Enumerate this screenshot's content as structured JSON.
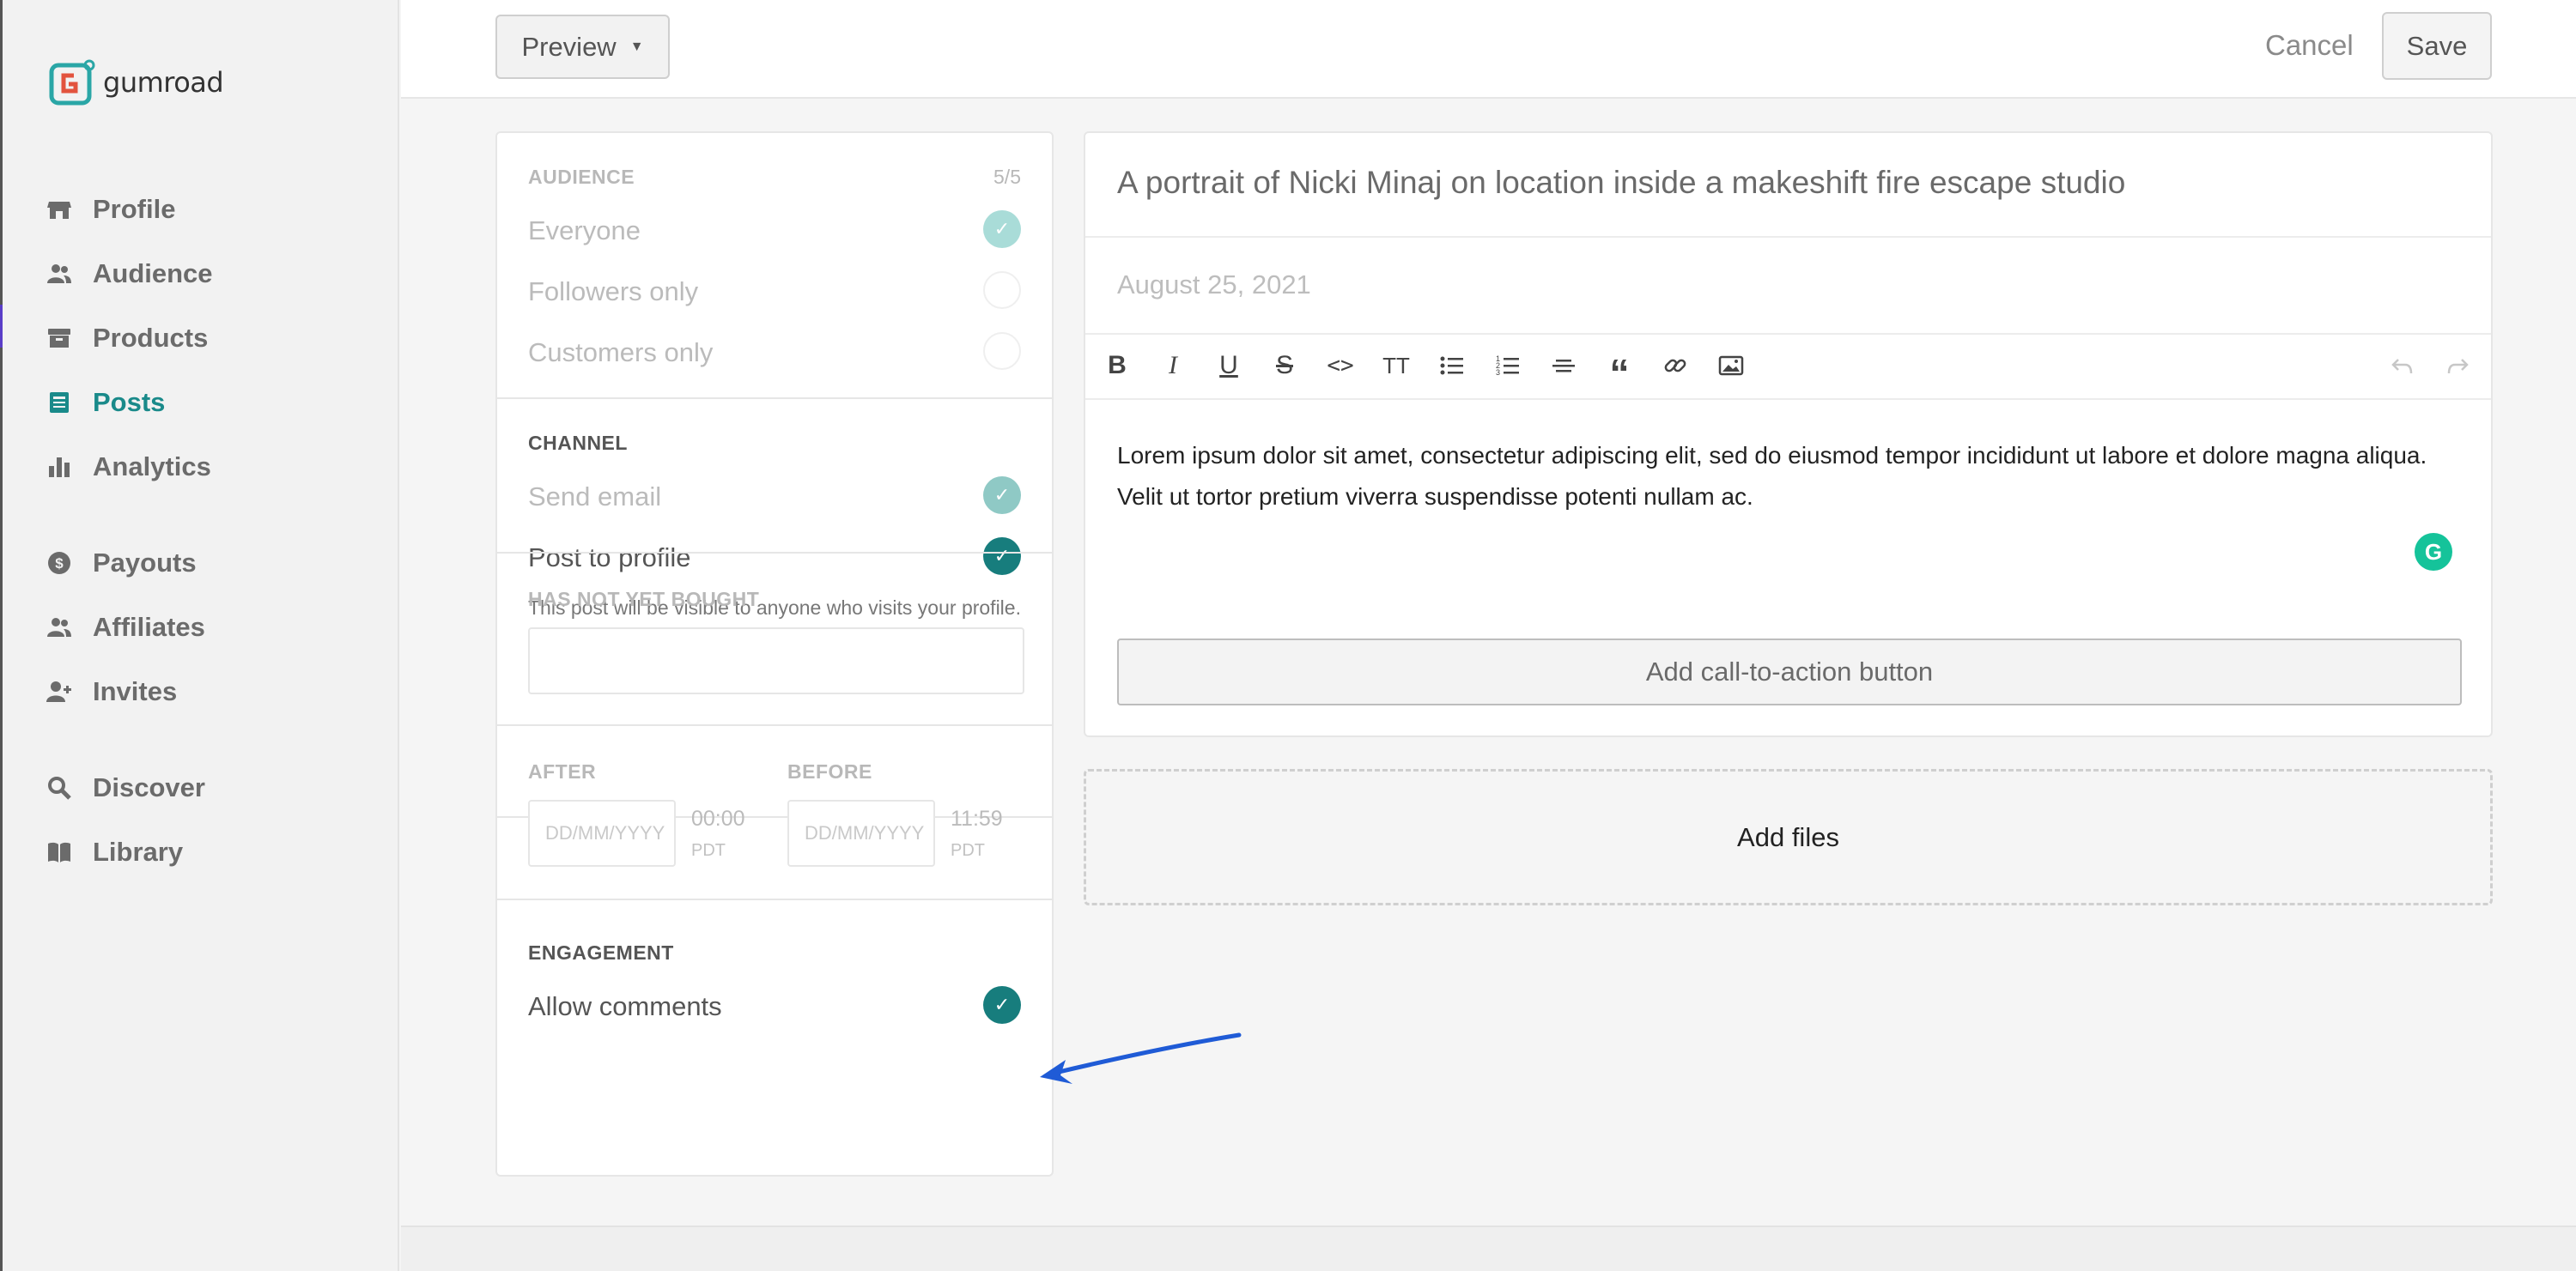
{
  "app": {
    "logo_text": "gumroad"
  },
  "sidebar": {
    "items": [
      {
        "label": "Profile",
        "icon": "store-icon",
        "active": false
      },
      {
        "label": "Audience",
        "icon": "users-icon",
        "active": false
      },
      {
        "label": "Products",
        "icon": "archive-icon",
        "active": false
      },
      {
        "label": "Posts",
        "icon": "newspaper-icon",
        "active": true
      },
      {
        "label": "Analytics",
        "icon": "bar-chart-icon",
        "active": false
      },
      {
        "label": "Payouts",
        "icon": "dollar-circle-icon",
        "active": false
      },
      {
        "label": "Affiliates",
        "icon": "users-icon",
        "active": false
      },
      {
        "label": "Invites",
        "icon": "user-plus-icon",
        "active": false
      },
      {
        "label": "Discover",
        "icon": "search-icon",
        "active": false
      },
      {
        "label": "Library",
        "icon": "book-icon",
        "active": false
      }
    ]
  },
  "topbar": {
    "preview_label": "Preview",
    "preview_caret": "▼",
    "cancel_label": "Cancel",
    "save_label": "Save"
  },
  "settings": {
    "audience": {
      "heading": "AUDIENCE",
      "count": "5/5",
      "options": [
        {
          "label": "Everyone",
          "checked": true
        },
        {
          "label": "Followers only",
          "checked": false
        },
        {
          "label": "Customers only",
          "checked": false
        }
      ]
    },
    "channel": {
      "heading": "CHANNEL",
      "options": [
        {
          "label": "Send email",
          "checked": true
        },
        {
          "label": "Post to profile",
          "checked": true
        }
      ],
      "help_text": "This post will be visible to anyone who visits your profile."
    },
    "has_not_yet_bought": {
      "heading": "HAS NOT YET BOUGHT",
      "value": ""
    },
    "dates": {
      "after_heading": "AFTER",
      "before_heading": "BEFORE",
      "after_placeholder": "DD/MM/YYYY",
      "before_placeholder": "DD/MM/YYYY",
      "after_time": "00:00",
      "before_time": "11:59",
      "after_tz": "PDT",
      "before_tz": "PDT"
    },
    "engagement": {
      "heading": "ENGAGEMENT",
      "option": {
        "label": "Allow comments",
        "checked": true
      }
    }
  },
  "editor": {
    "title": "A portrait of Nicki Minaj on location inside a makeshift fire escape studio",
    "date": "August 25, 2021",
    "body": "Lorem ipsum dolor sit amet, consectetur adipiscing elit, sed do eiusmod tempor incididunt ut labore et dolore magna aliqua. Velit ut tortor pretium viverra suspendisse potenti nullam ac.",
    "grammarly_letter": "G",
    "cta_label": "Add call-to-action button",
    "toolbar": {
      "bold": "B",
      "italic": "I",
      "underline": "U",
      "strikethrough": "S",
      "code": "<>",
      "text_size": "TT",
      "quote": "“"
    }
  },
  "files": {
    "label": "Add files"
  },
  "colors": {
    "accent": "#1a8a8a",
    "check_dark": "#177d7d",
    "annotation_arrow": "#1f5bd6"
  }
}
